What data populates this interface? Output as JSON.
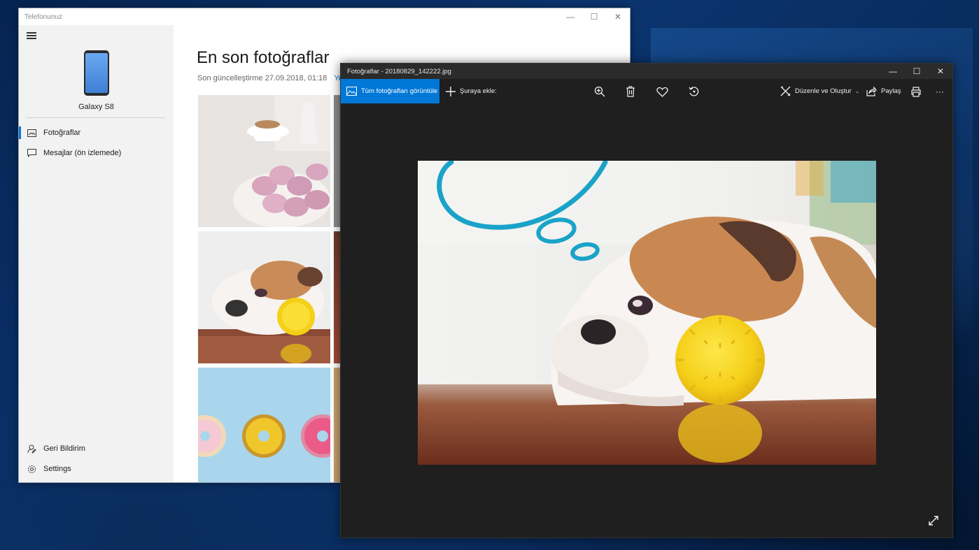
{
  "phone_window": {
    "title": "Telefonunuz",
    "device_name": "Galaxy S8",
    "nav": [
      {
        "label": "Fotoğraflar",
        "icon": "photos-icon",
        "active": true
      },
      {
        "label": "Mesajlar (ön izlemede)",
        "icon": "message-icon",
        "active": false
      }
    ],
    "bottom_nav": [
      {
        "label": "Geri Bildirim",
        "icon": "feedback-icon"
      },
      {
        "label": "Settings",
        "icon": "gear-icon"
      }
    ],
    "heading": "En son fotoğraflar",
    "last_updated": "Son güncelleştirme 27.09.2018, 01:18",
    "refresh_link": "Ye"
  },
  "photos_window": {
    "title": "Fotoğraflar - 20180829_142222.jpg",
    "toolbar": {
      "view_all": "Tüm fotoğrafları görüntüle",
      "add_to": "Şuraya ekle:",
      "edit_create": "Düzenle ve Oluştur",
      "share": "Paylaş",
      "more": "···"
    }
  },
  "colors": {
    "accent": "#0078d7",
    "viewer_bg": "#1f1f1f",
    "sidebar_bg": "#f2f2f2"
  }
}
